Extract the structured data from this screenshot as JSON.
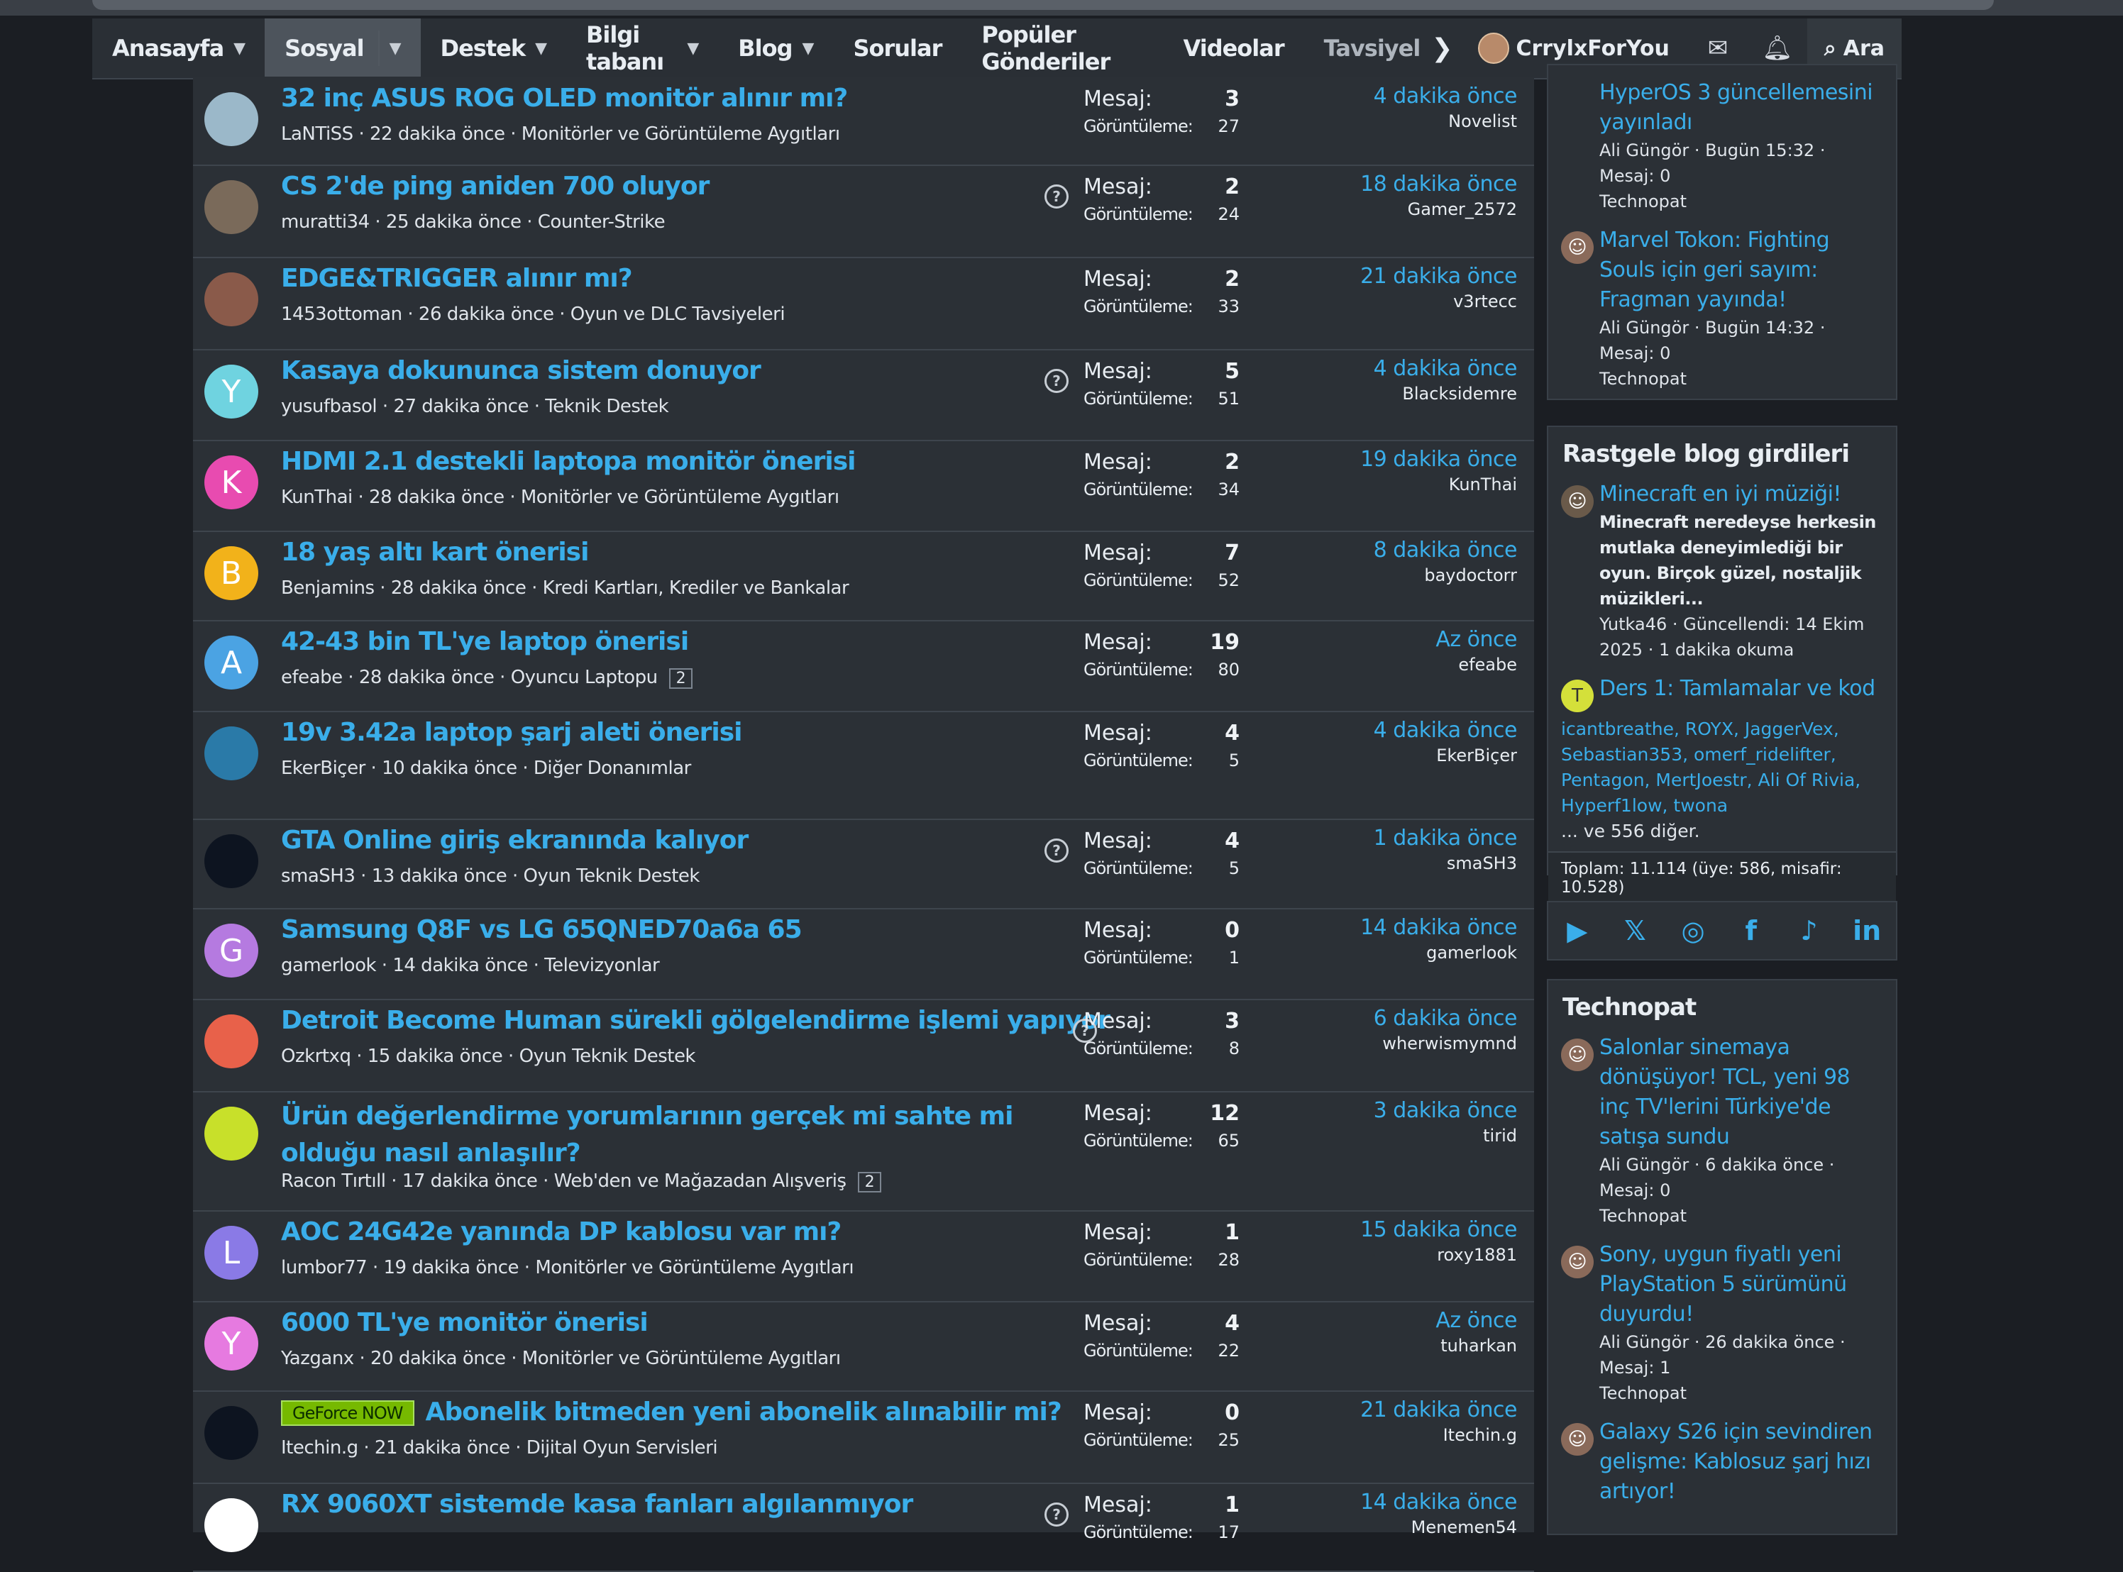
{
  "nav": {
    "items": [
      {
        "label": "Anasayfa",
        "caret": true
      },
      {
        "label": "Sosyal",
        "caret": true,
        "active": true
      },
      {
        "label": "Destek",
        "caret": true
      },
      {
        "label": "Bilgi tabanı",
        "caret": true
      },
      {
        "label": "Blog",
        "caret": true
      },
      {
        "label": "Sorular",
        "caret": false
      },
      {
        "label": "Popüler Gönderiler",
        "caret": false
      },
      {
        "label": "Videolar",
        "caret": false
      },
      {
        "label": "Tavsiyel",
        "caret": false
      }
    ],
    "user": "CrrylxForYou",
    "search_label": "Ara",
    "icons": [
      "chevron-right-icon",
      "mail-icon",
      "bell-icon",
      "search-icon"
    ]
  },
  "stat_labels": {
    "replies": "Mesaj:",
    "views": "Görüntüleme:"
  },
  "threads": [
    {
      "title": "32 inç ASUS ROG OLED monitör alınır mı?",
      "meta": "LaNTiSS · 22 dakika önce · Monitörler ve Görüntüleme Aygıtları",
      "replies": "3",
      "views": "27",
      "last_time": "4 dakika önce",
      "last_user": "Novelist",
      "avatar_letter": "",
      "avatar_color": "#9bb8c9",
      "question": false
    },
    {
      "title": "CS 2'de ping aniden 700 oluyor",
      "meta": "muratti34 · 25 dakika önce · Counter-Strike",
      "replies": "2",
      "views": "24",
      "last_time": "18 dakika önce",
      "last_user": "Gamer_2572",
      "avatar_letter": "",
      "avatar_color": "#7a6a5a",
      "question": true
    },
    {
      "title": "EDGE&TRIGGER alınır mı?",
      "meta": "1453ottoman · 26 dakika önce · Oyun ve DLC Tavsiyeleri",
      "replies": "2",
      "views": "33",
      "last_time": "21 dakika önce",
      "last_user": "v3rtecc",
      "avatar_letter": "",
      "avatar_color": "#8a5a4a",
      "question": false
    },
    {
      "title": "Kasaya dokununca sistem donuyor",
      "meta": "yusufbasol · 27 dakika önce · Teknik Destek",
      "replies": "5",
      "views": "51",
      "last_time": "4 dakika önce",
      "last_user": "Blacksidemre",
      "avatar_letter": "Y",
      "avatar_color": "#6fd3e0",
      "question": true
    },
    {
      "title": "HDMI 2.1 destekli laptopa monitör önerisi",
      "meta": "KunThai · 28 dakika önce · Monitörler ve Görüntüleme Aygıtları",
      "replies": "2",
      "views": "34",
      "last_time": "19 dakika önce",
      "last_user": "KunThai",
      "avatar_letter": "K",
      "avatar_color": "#e84bb0",
      "question": false
    },
    {
      "title": "18 yaş altı kart önerisi",
      "meta": "Benjamins · 28 dakika önce · Kredi Kartları, Krediler ve Bankalar",
      "replies": "7",
      "views": "52",
      "last_time": "8 dakika önce",
      "last_user": "baydoctorr",
      "avatar_letter": "B",
      "avatar_color": "#f2b21a",
      "question": false
    },
    {
      "title": "42-43 bin TL'ye laptop önerisi",
      "meta": "efeabe · 28 dakika önce · Oyuncu Laptopu",
      "page": "2",
      "replies": "19",
      "views": "80",
      "last_time": "Az önce",
      "last_user": "efeabe",
      "avatar_letter": "A",
      "avatar_color": "#4ba3e3",
      "question": false
    },
    {
      "title": "19v 3.42a laptop şarj aleti önerisi",
      "meta": "EkerBiçer · 10 dakika önce · Diğer Donanımlar",
      "replies": "4",
      "views": "5",
      "last_time": "4 dakika önce",
      "last_user": "EkerBiçer",
      "avatar_letter": "",
      "avatar_color": "#2a7aa8",
      "question": false
    },
    {
      "title": "GTA Online giriş ekranında kalıyor",
      "meta": "smaSH3 · 13 dakika önce · Oyun Teknik Destek",
      "replies": "4",
      "views": "5",
      "last_time": "1 dakika önce",
      "last_user": "smaSH3",
      "avatar_letter": "",
      "avatar_color": "#0d1420",
      "question": true
    },
    {
      "title": "Samsung Q8F vs LG 65QNED70a6a 65",
      "meta": "gamerlook · 14 dakika önce · Televizyonlar",
      "replies": "0",
      "views": "1",
      "last_time": "14 dakika önce",
      "last_user": "gamerlook",
      "avatar_letter": "G",
      "avatar_color": "#b57ae0",
      "question": false
    },
    {
      "title": "Detroit Become Human sürekli gölgelendirme işlemi yapıyor",
      "meta": "Ozkrtxq · 15 dakika önce · Oyun Teknik Destek",
      "replies": "3",
      "views": "8",
      "last_time": "6 dakika önce",
      "last_user": "wherwismymnd",
      "avatar_letter": "",
      "avatar_color": "#e8614a",
      "question": true
    },
    {
      "title": "Ürün değerlendirme yorumlarının gerçek mi sahte mi olduğu nasıl anlaşılır?",
      "meta": "Racon Tırtıll · 17 dakika önce · Web'den ve Mağazadan Alışveriş",
      "page": "2",
      "replies": "12",
      "views": "65",
      "last_time": "3 dakika önce",
      "last_user": "tirid",
      "avatar_letter": "",
      "avatar_color": "#c8e02a",
      "question": false
    },
    {
      "title": "AOC 24G42e yanında DP kablosu var mı?",
      "meta": "lumbor77 · 19 dakika önce · Monitörler ve Görüntüleme Aygıtları",
      "replies": "1",
      "views": "28",
      "last_time": "15 dakika önce",
      "last_user": "roxy1881",
      "avatar_letter": "L",
      "avatar_color": "#8a7ae6",
      "question": false
    },
    {
      "title": "6000 TL'ye monitör önerisi",
      "meta": "Yazganx · 20 dakika önce · Monitörler ve Görüntüleme Aygıtları",
      "replies": "4",
      "views": "22",
      "last_time": "Az önce",
      "last_user": "tuharkan",
      "avatar_letter": "Y",
      "avatar_color": "#e67ae0",
      "question": false
    },
    {
      "title": "Abonelik bitmeden yeni abonelik alınabilir mi?",
      "prefix": "GeForce NOW",
      "meta": "Itechin.g · 21 dakika önce · Dijital Oyun Servisleri",
      "replies": "0",
      "views": "25",
      "last_time": "21 dakika önce",
      "last_user": "Itechin.g",
      "avatar_letter": "",
      "avatar_color": "#0d1420",
      "question": false
    },
    {
      "title": "RX 9060XT sistemde kasa fanları algılanmıyor",
      "meta": "",
      "replies": "1",
      "views": "17",
      "last_time": "14 dakika önce",
      "last_user": "Menemen54",
      "avatar_letter": "",
      "avatar_color": "#ffffff",
      "question": true
    }
  ],
  "sidebar": {
    "top_news": [
      {
        "title": "HyperOS 3 güncellemesini yayınladı",
        "meta": "Ali Güngör · Bugün 15:32 · Mesaj: 0",
        "source": "Technopat"
      },
      {
        "title": "Marvel Tokon: Fighting Souls için geri sayım: Fragman yayında!",
        "meta": "Ali Güngör · Bugün 14:32 · Mesaj: 0",
        "source": "Technopat"
      }
    ],
    "blog": {
      "heading": "Rastgele blog girdileri",
      "entries": [
        {
          "title": "Minecraft en iyi müziği!",
          "desc": "Minecraft neredeyse herkesin mutlaka deneyimlediği bir oyun. Birçok güzel, nostaljik müzikleri...",
          "meta": "Yutka46 · Güncellendi: 14 Ekim 2025 · 1 dakika okuma"
        },
        {
          "title": "Ders 1: Tamlamalar ve kod",
          "desc": "",
          "meta": ""
        }
      ],
      "users": "icantbreathe, ROYX, JaggerVex, Sebastian353, omerf_ridelifter, Pentagon, MertJoestr, Ali Of Rivia, Hyperf1low, twona",
      "more": "... ve 556 diğer.",
      "total": "Toplam: 11.114 (üye: 586, misafir: 10.528)"
    },
    "social_icons": [
      "youtube-icon",
      "x-icon",
      "instagram-icon",
      "facebook-icon",
      "tiktok-icon",
      "linkedin-icon"
    ],
    "technopat": {
      "heading": "Technopat",
      "items": [
        {
          "title": "Salonlar sinemaya dönüşüyor! TCL, yeni 98 inç TV'lerini Türkiye'de satışa sundu",
          "meta": "Ali Güngör · 6 dakika önce · Mesaj: 0",
          "source": "Technopat"
        },
        {
          "title": "Sony, uygun fiyatlı yeni PlayStation 5 sürümünü duyurdu!",
          "meta": "Ali Güngör · 26 dakika önce · Mesaj: 1",
          "source": "Technopat"
        },
        {
          "title": "Galaxy S26 için sevindiren gelişme: Kablosuz şarj hızı artıyor!",
          "meta": "",
          "source": ""
        }
      ]
    }
  }
}
